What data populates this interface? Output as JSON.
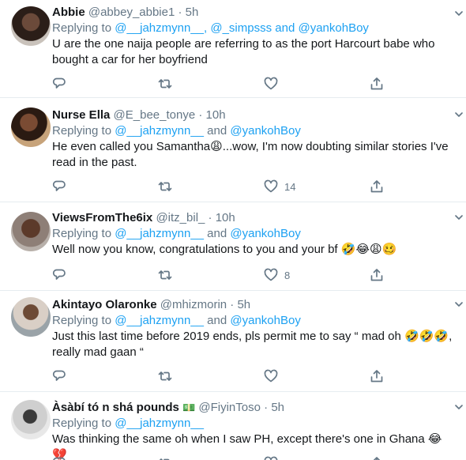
{
  "tweets": [
    {
      "name": "Abbie",
      "handle": "@abbey_abbie1",
      "dot": "·",
      "time": "5h",
      "replying_prefix": "Replying to ",
      "mentions": [
        "@__jahzmynn__",
        ", ",
        "@_simpsss",
        " and ",
        "@yankohBoy"
      ],
      "text_lines": [
        "U are the one naija people are referring to as the port Harcourt babe who",
        "bought a car for her boyfriend"
      ],
      "likes": ""
    },
    {
      "name": "Nurse Ella",
      "handle": "@E_bee_tonye",
      "dot": "·",
      "time": "10h",
      "replying_prefix": "Replying to ",
      "mentions": [
        "@__jahzmynn__",
        " and ",
        "@yankohBoy"
      ],
      "text_lines": [
        "He even called you Samantha😩...wow, I'm now doubting similar stories I've",
        "read in the past."
      ],
      "likes": "14"
    },
    {
      "name": "ViewsFromThe6ix",
      "handle": "@itz_bil_",
      "dot": "·",
      "time": "10h",
      "replying_prefix": "Replying to ",
      "mentions": [
        "@__jahzmynn__",
        " and ",
        "@yankohBoy"
      ],
      "text_lines": [
        "Well now you know, congratulations to you and your bf 🤣😂😩🥴"
      ],
      "likes": "8"
    },
    {
      "name": "Akintayo Olaronke",
      "handle": "@mhizmorin",
      "dot": "·",
      "time": "5h",
      "replying_prefix": "Replying to ",
      "mentions": [
        "@__jahzmynn__",
        " and ",
        "@yankohBoy"
      ],
      "text_lines": [
        "Just this last time before 2019 ends, pls permit me to say “ mad oh 🤣🤣🤣,",
        "really mad gaan “"
      ],
      "likes": ""
    },
    {
      "name": "Àsàbí tó n shá pounds",
      "name_emoji": "💵",
      "handle": "@FiyinToso",
      "dot": "·",
      "time": "5h",
      "replying_prefix": "Replying to ",
      "mentions": [
        "@__jahzmynn__"
      ],
      "text_lines": [
        "Was thinking the same oh when I saw PH, except there's one in Ghana 😂💔"
      ],
      "likes": ""
    }
  ],
  "icons": [
    "reply-icon",
    "retweet-icon",
    "like-icon",
    "share-icon",
    "chevron-down-icon"
  ],
  "colors": {
    "link": "#1da1f2",
    "secondary": "#657786",
    "border": "#e6ecf0"
  }
}
